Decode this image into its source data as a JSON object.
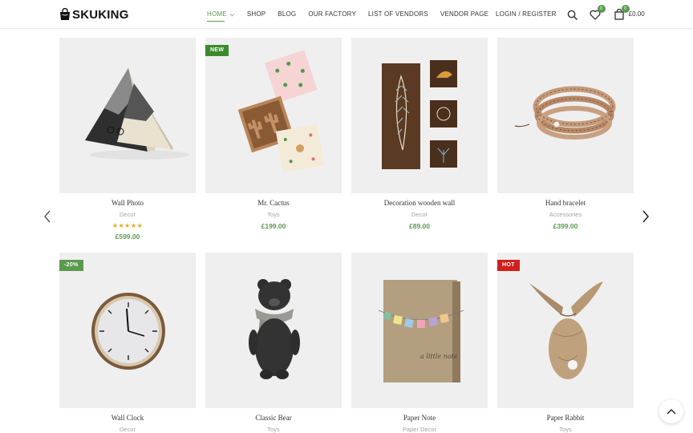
{
  "brand": {
    "logo_text": "SKUKING"
  },
  "nav": {
    "items": [
      {
        "label": "HOME"
      },
      {
        "label": "SHOP"
      },
      {
        "label": "BLOG"
      },
      {
        "label": "OUR FACTORY"
      },
      {
        "label": "LIST OF VENDORS"
      },
      {
        "label": "VENDOR PAGE"
      }
    ]
  },
  "header": {
    "login_label": "LOGIN / REGISTER",
    "wishlist_count": "0",
    "cart_count": "0",
    "cart_total": "£0.00"
  },
  "colors": {
    "accent": "#5a9a4e",
    "star": "#e6a71a",
    "tag_new": "#3d8a2e",
    "tag_sale": "#5a9a4e",
    "tag_hot": "#d0201d"
  },
  "products": [
    {
      "title": "Wall Photo",
      "category": "Decor",
      "price": "£599.00",
      "rating": 5,
      "stars": "★★★★★"
    },
    {
      "title": "Mr. Cactus",
      "category": "Toys",
      "price": "£199.00",
      "tag": "NEW"
    },
    {
      "title": "Decoration wooden wall",
      "category": "Decor",
      "price": "£89.00"
    },
    {
      "title": "Hand bracelet",
      "category": "Accessories",
      "price": "£399.00"
    },
    {
      "title": "Wall Clock",
      "category": "Decor",
      "tag": "-20%"
    },
    {
      "title": "Classic Bear",
      "category": "Toys"
    },
    {
      "title": "Paper Note",
      "category": "Paper Decor"
    },
    {
      "title": "Paper Rabbit",
      "category": "Toys",
      "tag": "HOT"
    }
  ]
}
